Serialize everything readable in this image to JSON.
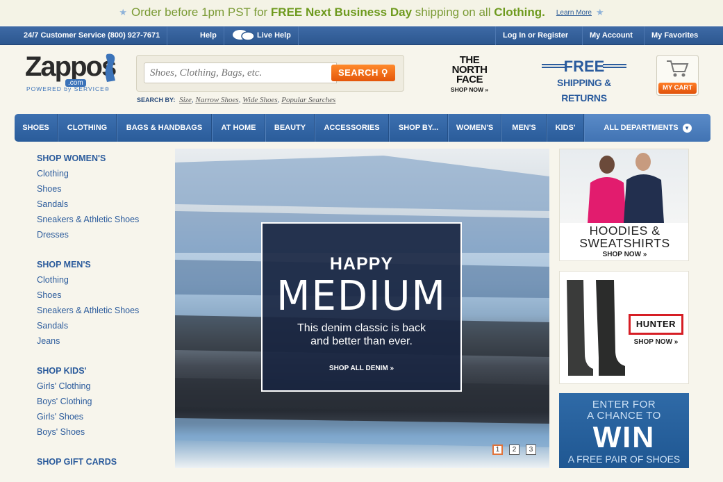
{
  "promo": {
    "message_pre": "Order before 1pm PST for ",
    "message_bold1": "FREE Next Business Day",
    "message_mid": " shipping on all ",
    "message_bold2": "Clothing.",
    "learn_more": "Learn More"
  },
  "utility": {
    "customer_service": "24/7 Customer Service (800) 927-7671",
    "help": "Help",
    "live_help": "Live Help",
    "login": "Log In or Register",
    "my_account": "My Account",
    "my_favorites": "My Favorites"
  },
  "logo": {
    "word": "Zappos",
    "com": ".com",
    "tagline": "POWERED by SERVICE®"
  },
  "search": {
    "placeholder": "Shoes, Clothing, Bags, etc.",
    "button": "SEARCH",
    "search_by_label": "SEARCH BY:",
    "links": [
      "Size",
      "Narrow Shoes",
      "Wide Shoes",
      "Popular Searches"
    ]
  },
  "north_face": {
    "line1": "THE",
    "line2": "NORTH",
    "line3": "FACE",
    "cta": "SHOP NOW »"
  },
  "free_shipping": {
    "line1": "FREE",
    "line2": "SHIPPING & RETURNS"
  },
  "cart": {
    "label": "MY CART"
  },
  "nav": {
    "items": [
      "SHOES",
      "CLOTHING",
      "BAGS & HANDBAGS",
      "AT HOME",
      "BEAUTY",
      "ACCESSORIES",
      "SHOP BY...",
      "WOMEN'S",
      "MEN'S",
      "KIDS'"
    ],
    "all": "ALL DEPARTMENTS"
  },
  "sidebar": {
    "women": {
      "heading": "SHOP WOMEN'S",
      "links": [
        "Clothing",
        "Shoes",
        "Sandals",
        "Sneakers & Athletic Shoes",
        "Dresses"
      ]
    },
    "men": {
      "heading": "SHOP MEN'S",
      "links": [
        "Clothing",
        "Shoes",
        "Sneakers & Athletic Shoes",
        "Sandals",
        "Jeans"
      ]
    },
    "kids": {
      "heading": "SHOP KIDS'",
      "links": [
        "Girls' Clothing",
        "Boys' Clothing",
        "Girls' Shoes",
        "Boys' Shoes"
      ]
    },
    "gift": {
      "heading": "SHOP GIFT CARDS"
    }
  },
  "hero": {
    "happy": "HAPPY",
    "medium": "MEDIUM",
    "line1": "This denim classic is back",
    "line2": "and better than ever.",
    "cta": "SHOP ALL DENIM »",
    "pages": [
      "1",
      "2",
      "3"
    ],
    "active_page": "1"
  },
  "ads": {
    "hoodies": {
      "line1": "HOODIES &",
      "line2": "SWEATSHIRTS",
      "cta": "SHOP NOW »"
    },
    "hunter": {
      "brand": "HUNTER",
      "cta": "SHOP NOW »"
    },
    "win": {
      "line1": "ENTER FOR",
      "line2": "A CHANCE TO",
      "big": "WIN",
      "line3": "A FREE PAIR OF SHOES"
    }
  },
  "colors": {
    "brand_blue": "#2b5b9c",
    "accent_orange": "#e4560a",
    "promo_green": "#6e9a1e"
  }
}
